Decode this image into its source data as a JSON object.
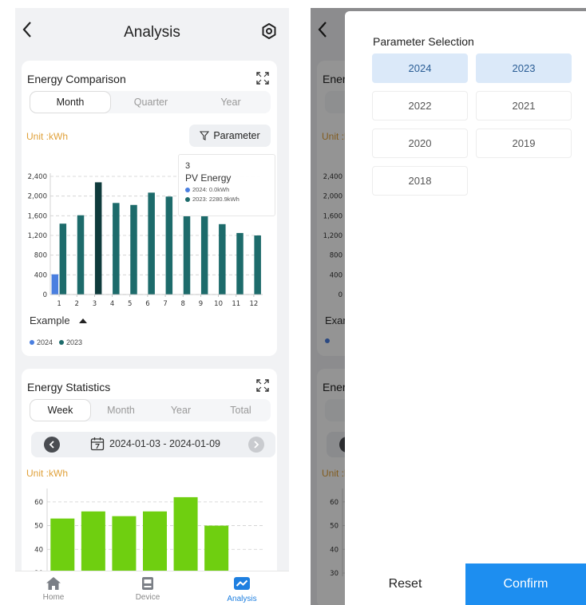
{
  "header": {
    "title": "Analysis",
    "back_icon": "chevron-left-icon",
    "settings_icon": "gear-icon"
  },
  "comparison": {
    "title": "Energy Comparison",
    "tabs": [
      "Month",
      "Quarter",
      "Year"
    ],
    "active_tab": "Month",
    "unit": "Unit :kWh",
    "parameter_label": "Parameter",
    "tooltip": {
      "title": "3",
      "series_name": "PV Energy",
      "rows": [
        {
          "text": "2024: 0.0kWh",
          "color": "#4a7fe0"
        },
        {
          "text": "2023: 2280.9kWh",
          "color": "#1d6b6b"
        }
      ]
    },
    "example_label": "Example"
  },
  "statistics": {
    "title": "Energy Statistics",
    "tabs": [
      "Week",
      "Month",
      "Year",
      "Total"
    ],
    "active_tab": "Week",
    "date_range": "2024-01-03 - 2024-01-09",
    "unit": "Unit :kWh"
  },
  "tabbar": {
    "items": [
      {
        "label": "Home",
        "icon": "home-icon"
      },
      {
        "label": "Device",
        "icon": "device-icon"
      },
      {
        "label": "Analysis",
        "icon": "analysis-icon"
      }
    ],
    "active": "Analysis"
  },
  "drawer": {
    "title": "Parameter Selection",
    "years": [
      "2024",
      "2023",
      "2022",
      "2021",
      "2020",
      "2019",
      "2018"
    ],
    "selected": [
      "2024",
      "2023"
    ],
    "reset_label": "Reset",
    "confirm_label": "Confirm"
  },
  "colors": {
    "series_2024": "#4a7fe0",
    "series_2023": "#1d6b6b",
    "series_2023_highlight": "#0f3b3c",
    "statistics_bar": "#6fcf10",
    "accent": "#1d8ef0",
    "unit_text": "#e0a13a"
  },
  "chart_data": [
    {
      "type": "bar",
      "categories": [
        "1",
        "2",
        "3",
        "4",
        "5",
        "6",
        "7",
        "8",
        "9",
        "10",
        "11",
        "12"
      ],
      "series": [
        {
          "name": "2024",
          "values": [
            410,
            0,
            0,
            0,
            0,
            0,
            0,
            0,
            0,
            0,
            0,
            0
          ]
        },
        {
          "name": "2023",
          "values": [
            1440,
            1610,
            2280,
            1860,
            1820,
            2070,
            1990,
            1600,
            1600,
            1430,
            1250,
            1200
          ]
        }
      ],
      "yticks": [
        "0",
        "400",
        "800",
        "1,200",
        "1,600",
        "2,000",
        "2,400"
      ],
      "ylim": [
        0,
        2400
      ],
      "highlight_index": 2,
      "legend": "bottom-left",
      "grid": true
    },
    {
      "type": "bar",
      "categories": [
        "",
        "",
        "",
        "",
        "",
        "",
        ""
      ],
      "series": [
        {
          "values": [
            53,
            56,
            54,
            56,
            62,
            50,
            0
          ]
        }
      ],
      "yticks": [
        "30",
        "40",
        "50",
        "60"
      ],
      "ylim": [
        30,
        65
      ],
      "grid": true
    }
  ]
}
